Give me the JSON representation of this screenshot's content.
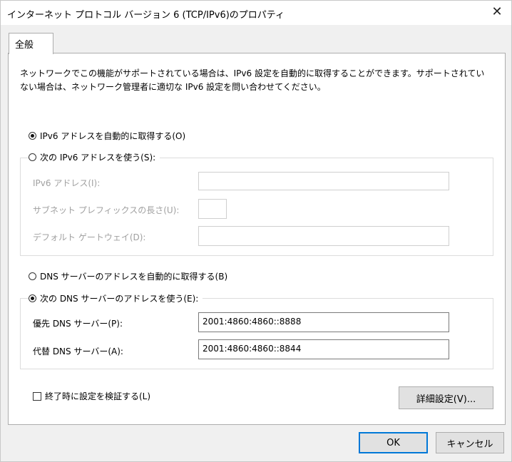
{
  "window": {
    "title": "インターネット プロトコル バージョン 6 (TCP/IPv6)のプロパティ",
    "close_glyph": "✕"
  },
  "tabs": [
    {
      "label": "全般",
      "selected": true
    }
  ],
  "description": "ネットワークでこの機能がサポートされている場合は、IPv6 設定を自動的に取得することができます。サポートされていない場合は、ネットワーク管理者に適切な IPv6 設定を問い合わせてください。",
  "ip_section": {
    "auto_option": {
      "label": "IPv6 アドレスを自動的に取得する(O)",
      "selected": true
    },
    "manual_option": {
      "label": "次の IPv6 アドレスを使う(S):",
      "selected": false
    },
    "fields": {
      "address": {
        "label": "IPv6 アドレス(I):",
        "value": ""
      },
      "prefix": {
        "label": "サブネット プレフィックスの長さ(U):",
        "value": ""
      },
      "gateway": {
        "label": "デフォルト ゲートウェイ(D):",
        "value": ""
      }
    }
  },
  "dns_section": {
    "auto_option": {
      "label": "DNS サーバーのアドレスを自動的に取得する(B)",
      "selected": false
    },
    "manual_option": {
      "label": "次の DNS サーバーのアドレスを使う(E):",
      "selected": true
    },
    "preferred": {
      "label": "優先 DNS サーバー(P):",
      "value": "2001:4860:4860::8888"
    },
    "alternate": {
      "label": "代替 DNS サーバー(A):",
      "value": "2001:4860:4860::8844"
    }
  },
  "validate": {
    "label": "終了時に設定を検証する(L)",
    "checked": false
  },
  "buttons": {
    "advanced": "詳細設定(V)...",
    "ok": "OK",
    "cancel": "キャンセル"
  }
}
